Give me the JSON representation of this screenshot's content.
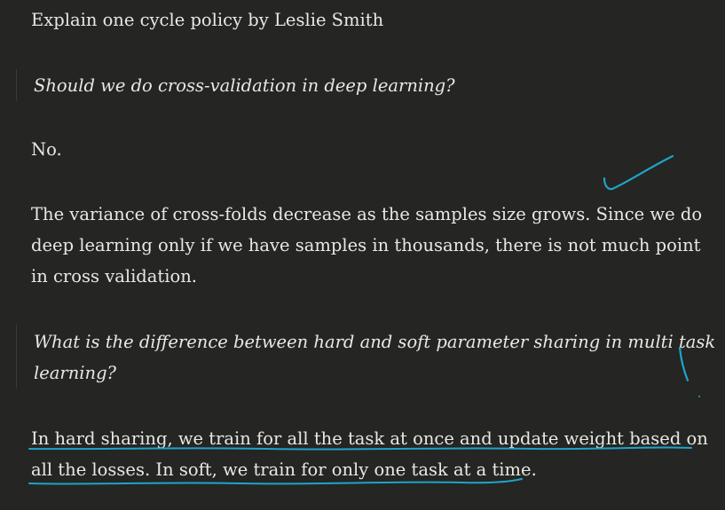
{
  "document": {
    "heading_line": "Explain one cycle policy by Leslie Smith",
    "question_1": "Should we do cross-validation in deep learning?",
    "answer_1_short": "No.",
    "answer_1_lines": [
      "The variance of cross-folds decrease as the samples size grows. Since we do",
      "deep learning only if we have samples in thousands, there is not much point",
      "in cross validation."
    ],
    "question_2_lines": [
      "What is the difference between hard and soft parameter sharing in multi task",
      "learning?"
    ],
    "answer_2_lines": [
      "In hard sharing, we train for all the task at once and update weight based on",
      "all the losses. In soft, we train for only one task at a time."
    ]
  },
  "annotations": {
    "ink_color": "#1fa3c9",
    "marks": [
      "checkmark",
      "vertical-tick",
      "underline-line-1",
      "underline-line-2"
    ]
  }
}
